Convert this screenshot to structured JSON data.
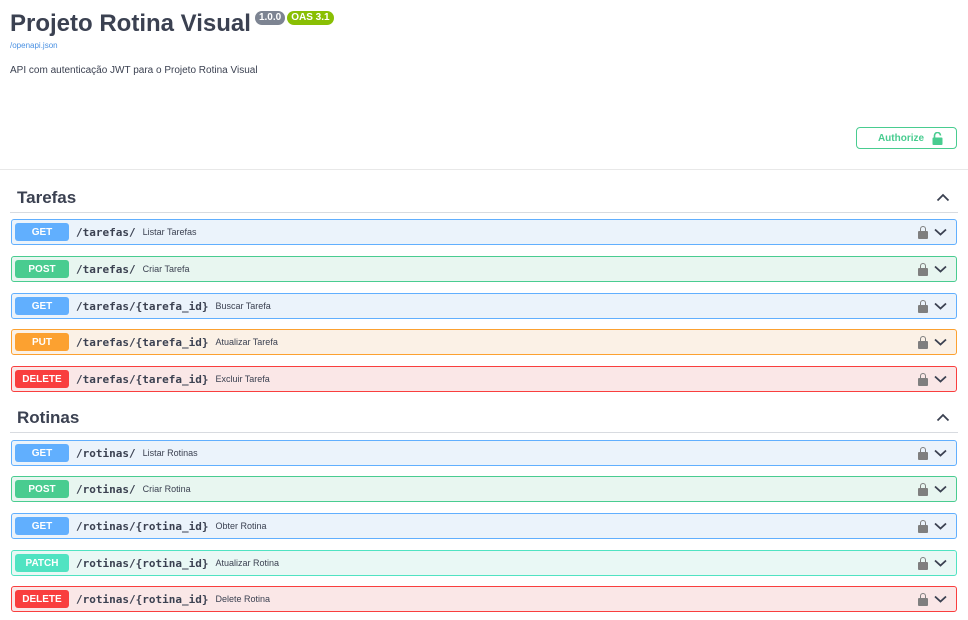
{
  "info": {
    "title": "Projeto Rotina Visual",
    "version": "1.0.0",
    "oas": "OAS 3.1",
    "spec_link": "/openapi.json",
    "description": "API com autenticação JWT para o Projeto Rotina Visual"
  },
  "authorize": {
    "label": "Authorize"
  },
  "tags": [
    {
      "name": "Tarefas",
      "operations": [
        {
          "method": "GET",
          "path": "/tarefas/",
          "summary": "Listar Tarefas"
        },
        {
          "method": "POST",
          "path": "/tarefas/",
          "summary": "Criar Tarefa"
        },
        {
          "method": "GET",
          "path": "/tarefas/{tarefa_id}",
          "summary": "Buscar Tarefa"
        },
        {
          "method": "PUT",
          "path": "/tarefas/{tarefa_id}",
          "summary": "Atualizar Tarefa"
        },
        {
          "method": "DELETE",
          "path": "/tarefas/{tarefa_id}",
          "summary": "Excluir Tarefa"
        }
      ]
    },
    {
      "name": "Rotinas",
      "operations": [
        {
          "method": "GET",
          "path": "/rotinas/",
          "summary": "Listar Rotinas"
        },
        {
          "method": "POST",
          "path": "/rotinas/",
          "summary": "Criar Rotina"
        },
        {
          "method": "GET",
          "path": "/rotinas/{rotina_id}",
          "summary": "Obter Rotina"
        },
        {
          "method": "PATCH",
          "path": "/rotinas/{rotina_id}",
          "summary": "Atualizar Rotina"
        },
        {
          "method": "DELETE",
          "path": "/rotinas/{rotina_id}",
          "summary": "Delete Rotina"
        }
      ]
    }
  ],
  "colors": {
    "get": "#61affe",
    "post": "#49cc90",
    "put": "#fca130",
    "delete": "#f93e3e",
    "patch": "#50e3c2"
  }
}
